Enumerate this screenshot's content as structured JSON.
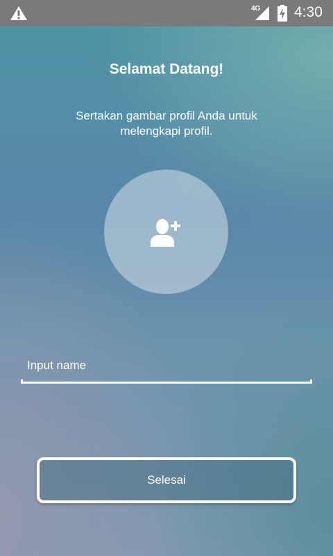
{
  "status_bar": {
    "warning_icon": "warning-triangle-icon",
    "network_label": "4G",
    "signal_icon": "signal-icon",
    "battery_icon": "battery-charging-icon",
    "time": "4:30"
  },
  "welcome": {
    "title": "Selamat Datang!",
    "subtitle": "Sertakan gambar profil Anda untuk melengkapi profil."
  },
  "avatar": {
    "icon": "add-user-icon"
  },
  "name_input": {
    "placeholder": "Input name",
    "value": ""
  },
  "actions": {
    "done_label": "Selesai"
  }
}
